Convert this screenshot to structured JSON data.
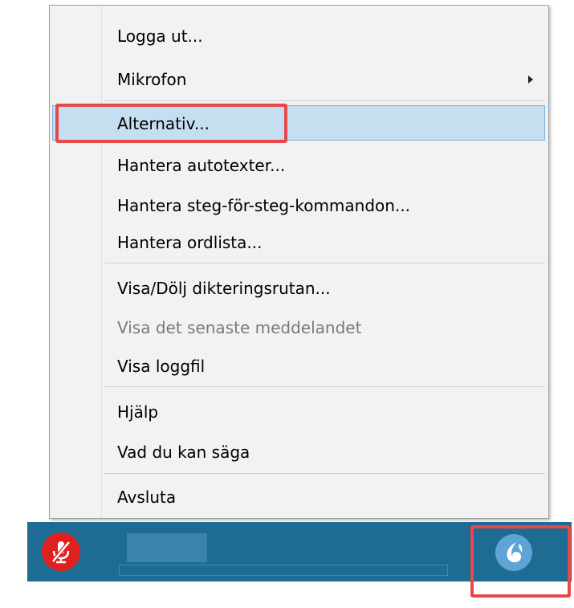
{
  "menu": {
    "items": [
      {
        "label": "Logga ut...",
        "disabled": false,
        "submenu": false
      },
      {
        "label": "Mikrofon",
        "disabled": false,
        "submenu": true
      },
      {
        "label": "Alternativ...",
        "disabled": false,
        "submenu": false,
        "highlighted": true
      },
      {
        "label": "Hantera autotexter...",
        "disabled": false,
        "submenu": false
      },
      {
        "label": "Hantera steg-för-steg-kommandon...",
        "disabled": false,
        "submenu": false
      },
      {
        "label": "Hantera ordlista...",
        "disabled": false,
        "submenu": false
      },
      {
        "label": "Visa/Dölj dikteringsrutan...",
        "disabled": false,
        "submenu": false
      },
      {
        "label": "Visa det senaste meddelandet",
        "disabled": true,
        "submenu": false
      },
      {
        "label": "Visa loggfil",
        "disabled": false,
        "submenu": false
      },
      {
        "label": "Hjälp",
        "disabled": false,
        "submenu": false
      },
      {
        "label": "Vad du kan säga",
        "disabled": false,
        "submenu": false
      },
      {
        "label": "Avsluta",
        "disabled": false,
        "submenu": false
      }
    ]
  },
  "dragon_bar": {
    "mic_icon": "microphone-off-icon",
    "dragon_icon": "dragon-logo-icon"
  },
  "colors": {
    "bar_background": "#1e6b94",
    "highlight": "#c5def0",
    "annotation": "#e8474b",
    "mic_off": "#e0201f"
  }
}
